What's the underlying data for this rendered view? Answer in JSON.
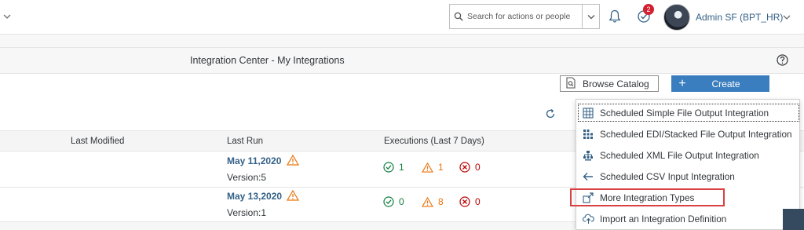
{
  "shell": {
    "search_placeholder": "Search for actions or people",
    "notification_count": "2",
    "user_name": "Admin SF (BPT_HR)"
  },
  "page": {
    "title": "Integration Center - My Integrations"
  },
  "toolbar": {
    "browse_label": "Browse Catalog",
    "create_label": "Create"
  },
  "table": {
    "columns": {
      "last_modified": "Last Modified",
      "last_run": "Last Run",
      "executions": "Executions (Last 7 Days)"
    },
    "rows": [
      {
        "last_run": "May 11,2020",
        "version": "Version:5",
        "success": "1",
        "warning": "1",
        "error": "0"
      },
      {
        "last_run": "May 13,2020",
        "version": "Version:1",
        "success": "0",
        "warning": "8",
        "error": "0"
      }
    ]
  },
  "create_menu": {
    "items": [
      {
        "label": "Scheduled Simple File Output Integration",
        "icon": "grid-icon"
      },
      {
        "label": "Scheduled EDI/Stacked File Output Integration",
        "icon": "stacked-grid-icon"
      },
      {
        "label": "Scheduled XML File Output Integration",
        "icon": "hierarchy-icon"
      },
      {
        "label": "Scheduled CSV Input Integration",
        "icon": "arrow-left-icon"
      },
      {
        "label": "More Integration Types",
        "icon": "more-types-icon"
      },
      {
        "label": "Import an Integration Definition",
        "icon": "upload-cloud-icon"
      }
    ]
  },
  "colors": {
    "accent": "#3b7ebf",
    "link": "#346187",
    "success": "#107e3e",
    "warning": "#e9730c",
    "error": "#bb0000",
    "highlight_box": "#d94040"
  }
}
